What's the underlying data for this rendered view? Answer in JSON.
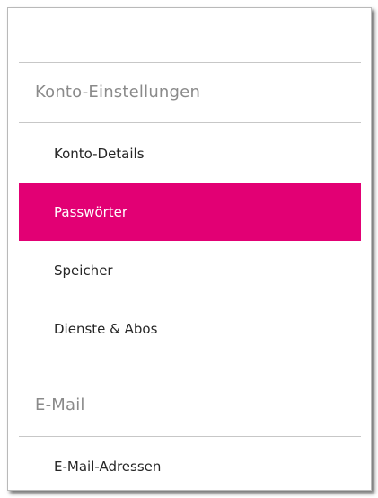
{
  "sections": [
    {
      "title": "Konto-Einstellungen",
      "items": [
        {
          "label": "Konto-Details",
          "active": false
        },
        {
          "label": "Passwörter",
          "active": true
        },
        {
          "label": "Speicher",
          "active": false
        },
        {
          "label": "Dienste & Abos",
          "active": false
        }
      ]
    },
    {
      "title": "E-Mail",
      "items": [
        {
          "label": "E-Mail-Adressen",
          "active": false
        }
      ]
    }
  ],
  "colors": {
    "accent": "#e20074",
    "section_title": "#8a8a8a",
    "item_text": "#262626",
    "divider": "#c7c7c7"
  }
}
